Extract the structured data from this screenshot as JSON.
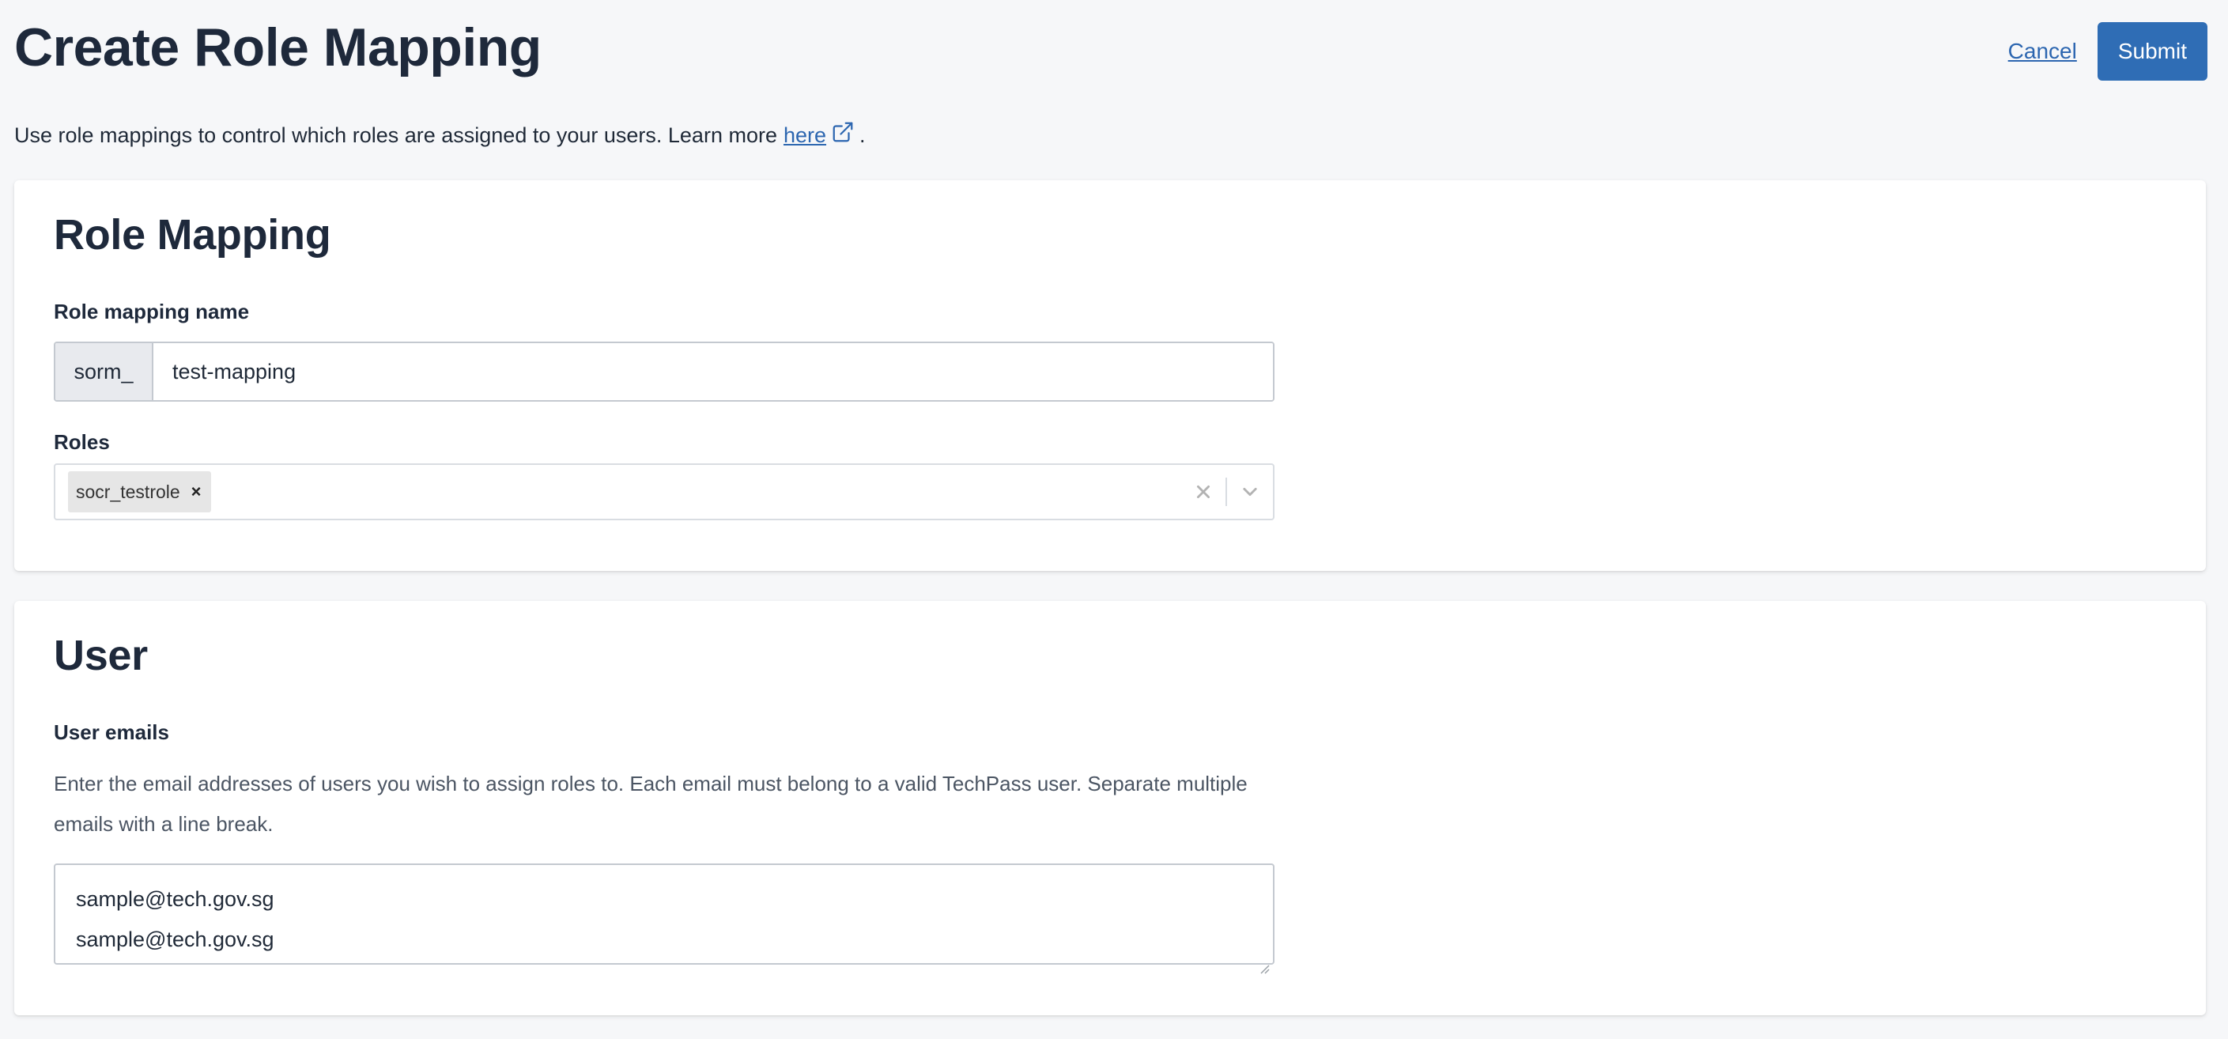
{
  "header": {
    "title": "Create Role Mapping",
    "cancel_label": "Cancel",
    "submit_label": "Submit"
  },
  "intro": {
    "text": "Use role mappings to control which roles are assigned to your users. Learn more",
    "link_label": "here",
    "period": "."
  },
  "role_mapping": {
    "title": "Role Mapping",
    "name_label": "Role mapping name",
    "name_prefix": "sorm_",
    "name_value": "test-mapping",
    "roles_label": "Roles",
    "roles": [
      "socr_testrole"
    ],
    "chip_remove_glyph": "×"
  },
  "user": {
    "title": "User",
    "emails_label": "User emails",
    "help_text": "Enter the email addresses of users you wish to assign roles to. Each email must belong to a valid TechPass user. Separate multiple emails with a line break.",
    "emails": [
      "sample@tech.gov.sg",
      "sample@tech.gov.sg"
    ]
  },
  "colors": {
    "accent": "#2f6db5",
    "link": "#2c66b0",
    "title": "#1e293b",
    "background": "#f6f7f9"
  },
  "icons": {
    "external_link": "external-link-icon",
    "clear": "close-icon",
    "dropdown": "chevron-down-icon"
  }
}
